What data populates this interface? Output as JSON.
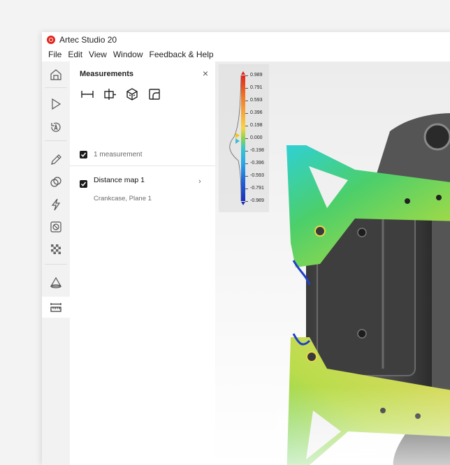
{
  "app": {
    "title": "Artec Studio 20",
    "accent": "#e2241b"
  },
  "menu": [
    "File",
    "Edit",
    "View",
    "Window",
    "Feedback & Help"
  ],
  "toolbar": {
    "tools": [
      {
        "name": "home-icon",
        "active": false
      },
      {
        "name": "play-icon",
        "active": false
      },
      {
        "name": "autopilot-icon",
        "active": false
      },
      {
        "name": "pencil-icon",
        "active": false
      },
      {
        "name": "align-icon",
        "active": false
      },
      {
        "name": "lightning-icon",
        "active": false
      },
      {
        "name": "prohibit-icon",
        "active": false
      },
      {
        "name": "texture-icon",
        "active": false
      },
      {
        "name": "cone-icon",
        "active": false
      },
      {
        "name": "measure-icon",
        "active": true
      }
    ]
  },
  "panel": {
    "title": "Measurements",
    "close": "×",
    "tools": [
      "distance-tool-icon",
      "section-tool-icon",
      "surface-distance-icon",
      "area-icon"
    ],
    "summary": "1 measurement",
    "item": {
      "name": "Distance map 1",
      "subtitle": "Crankcase, Plane 1",
      "chevron": "›"
    }
  },
  "scale": {
    "labels": [
      "0.989",
      "0.791",
      "0.593",
      "0.396",
      "0.198",
      "0.000",
      "-0.198",
      "-0.396",
      "-0.593",
      "-0.791",
      "-0.989"
    ]
  }
}
